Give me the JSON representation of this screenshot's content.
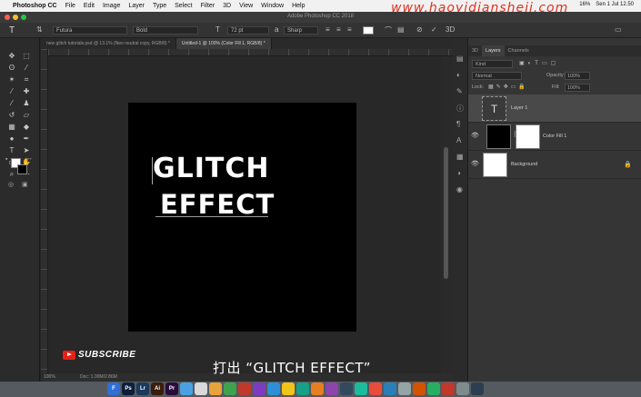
{
  "menubar": {
    "app_name": "Photoshop CC",
    "items": [
      "File",
      "Edit",
      "Image",
      "Layer",
      "Type",
      "Select",
      "Filter",
      "3D",
      "View",
      "Window",
      "Help"
    ],
    "status": {
      "battery": "16%",
      "clock": "Sen 1 Jul 12.50"
    }
  },
  "watermark": "www.haoyidiansheji.com",
  "window": {
    "title": "Adobe Photoshop CC 2018"
  },
  "options": {
    "font_family": "Futura",
    "font_style": "Bold",
    "font_size": "72 pt",
    "antialias": "Sharp",
    "text_color": "#ffffff"
  },
  "tabs": [
    {
      "label": "new glitch tutorials.psd @ 13.1% (Neo neutral copy, RGB/8) *"
    },
    {
      "label": "Untitled-1 @ 100% (Color Fill 1, RGB/8) *"
    }
  ],
  "canvas": {
    "line1": "GLITCH",
    "line2": "EFFECT"
  },
  "statusbar": {
    "zoom": "100%",
    "doc": "Doc: 1.00M/2.86M"
  },
  "panels": {
    "tabs": [
      "3D",
      "Layers",
      "Channels"
    ],
    "kind": "Kind",
    "blend_mode": "Normal",
    "opacity_label": "Opacity:",
    "opacity_value": "100%",
    "lock_label": "Lock:",
    "fill_label": "Fill:",
    "fill_value": "100%",
    "layers": [
      {
        "name": "Layer 1"
      },
      {
        "name": "Color Fill 1"
      },
      {
        "name": "Background"
      }
    ]
  },
  "overlay": {
    "subscribe": "SUBSCRIBE",
    "caption": "打出 “GLITCH EFFECT”"
  },
  "dock": [
    "F",
    "Ps",
    "Lr",
    "Ai",
    "Pr",
    "",
    "",
    "",
    "",
    "",
    "",
    "",
    "",
    "",
    "",
    "",
    "",
    "",
    "",
    "",
    "",
    "",
    "",
    "",
    "",
    ""
  ]
}
